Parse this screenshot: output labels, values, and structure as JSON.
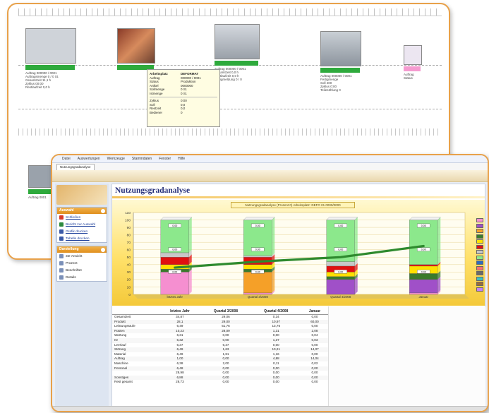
{
  "back_window": {
    "machines": [
      {
        "bar_color": "#2eaa3c",
        "img_color": "#cfd3d9",
        "text": "Auftrag 000000 / 0001\nAuftragsmenge 0 / 0 St.\nGesamtzeit 11,1 h\nZyklus 00:00\nRestlaufzeit 0,0 h"
      },
      {
        "bar_color": "#2eaa3c",
        "img_color": "#a7684e",
        "text": ""
      },
      {
        "bar_color": "#2eaa3c",
        "img_color": "#c2c6cc",
        "text": "Auftrag 000000 / 0001\nGesamtzeit 0,0 h\nRestlaufzeit 0,0 h\nFertigmeldung 0 / 0"
      },
      {
        "bar_color": "#2eaa3c",
        "img_color": "#b9c0c7",
        "text": "Auftrag 000000 / 0001\nFertigmenge\nSoll 400\nZyklus 0:00\nTeilezählung 0"
      },
      {
        "bar_color": "#f59bd0",
        "img_color": "#e9e3ef",
        "text": "Auftrag\nStatus"
      },
      {
        "bar_color": "#2eaa3c",
        "img_color": "#9aa2ab",
        "text": "Auftrag 0001"
      }
    ],
    "tooltip": {
      "rows": [
        [
          "Arbeitsplatz",
          "DEFORMAT"
        ],
        [
          "Auftrag",
          "000000 / 0001"
        ],
        [
          "Status",
          "Produktion"
        ],
        [
          "Artikel",
          "0000000"
        ],
        [
          "Sollmenge",
          "0 St."
        ],
        [
          "Istmenge",
          "0 St."
        ]
      ],
      "rows2": [
        [
          "Zyklus",
          "0:00"
        ],
        [
          "Soll",
          "0,0"
        ],
        [
          "Restzeit",
          "0,0"
        ],
        [
          "Bediener",
          "0"
        ]
      ]
    }
  },
  "menubar": [
    "Datei",
    "Auswertungen",
    "Werkzeuge",
    "Stammdaten",
    "Fenster",
    "Hilfe"
  ],
  "tab_label": "Nutzungsgradanalyse",
  "sidebar": {
    "panel1": {
      "title": "Auswahl",
      "items": [
        {
          "label": "Schließen",
          "color": "#d93a2b"
        },
        {
          "label": "Bericht zur Auswahl",
          "color": "#2e8a3e"
        },
        {
          "label": "Grafik drucken",
          "color": "#3b5aa8"
        },
        {
          "label": "Tabelle drucken",
          "color": "#3b5aa8"
        }
      ]
    },
    "panel2": {
      "title": "Darstellung",
      "items": [
        {
          "label": "3D-Ansicht",
          "color": "#7a8fb8"
        },
        {
          "label": "Prozent",
          "color": "#7a8fb8"
        },
        {
          "label": "Beschriftet",
          "color": "#7a8fb8"
        },
        {
          "label": "Details",
          "color": "#7a8fb8"
        }
      ]
    }
  },
  "page_title": "Nutzungsgradanalyse",
  "chart_data": {
    "type": "bar",
    "stacked": true,
    "title": "Nutzungsgradanalyse (Prozent 0)   Arbeitsplatz: DEFO 01   0000/0000",
    "categories": [
      "letztes Jahr",
      "Quartal 3/2008",
      "Quartal 4/2008",
      "Januar"
    ],
    "ylim": [
      0,
      110
    ],
    "yticks": [
      0,
      10,
      20,
      30,
      40,
      50,
      60,
      70,
      80,
      90,
      100,
      110
    ],
    "series": [
      {
        "color": "#f58fd0",
        "values": [
          30,
          2,
          0,
          2
        ]
      },
      {
        "color": "#a050c8",
        "values": [
          0,
          0,
          20,
          18
        ]
      },
      {
        "color": "#f5a028",
        "values": [
          0,
          28,
          0,
          0
        ]
      },
      {
        "color": "#3a7a2c",
        "values": [
          4,
          4,
          4,
          8
        ]
      },
      {
        "color": "#ffe000",
        "values": [
          6,
          6,
          6,
          10
        ]
      },
      {
        "color": "#e01010",
        "values": [
          10,
          10,
          8,
          2
        ]
      },
      {
        "color": "#c8c8c8",
        "values": [
          6,
          2,
          6,
          0
        ]
      },
      {
        "color": "#8ce88c",
        "values": [
          44,
          48,
          56,
          60
        ]
      }
    ],
    "trend": {
      "color": "#2e8a2e",
      "values": [
        36,
        44,
        50,
        65
      ]
    },
    "data_labels": [
      "0,00",
      "0,00",
      "0,00",
      "0,00",
      "0,00",
      "0,00"
    ],
    "legend_colors": [
      "#f58fd0",
      "#a050c8",
      "#f5a028",
      "#3a7a2c",
      "#ffe000",
      "#e01010",
      "#c8c8c8",
      "#8ce88c",
      "#2e6bbf",
      "#ff7070",
      "#6a6a6a",
      "#3cc0c0",
      "#9b6b3a",
      "#c080ff"
    ],
    "legend_placement": "right"
  },
  "table": {
    "headers": [
      "",
      "letztes Jahr",
      "Quartal 3/2008",
      "Quartal 4/2008",
      "Januar"
    ],
    "rows": [
      [
        "Gesamtzeit",
        "34,87",
        "29,06",
        "0,34",
        "0,00"
      ],
      [
        "Produkt",
        "28,1",
        "29,00",
        "10,97",
        "60,00"
      ],
      [
        "Leistungsstufe",
        "6,49",
        "51,76",
        "13,76",
        "0,00"
      ],
      [
        "Rüsten",
        "10,23",
        "28,09",
        "1,31",
        "2,08"
      ],
      [
        "Wartung",
        "6,31",
        "0,00",
        "0,00",
        "0,04"
      ],
      [
        "IO",
        "6,32",
        "0,00",
        "1,37",
        "0,03"
      ],
      [
        "Leerlauf",
        "6,37",
        "6,37",
        "0,00",
        "0,00"
      ],
      [
        "Störung",
        "6,49",
        "1,63",
        "10,21",
        "14,07"
      ],
      [
        "Material",
        "6,49",
        "1,81",
        "1,16",
        "0,00"
      ],
      [
        "Auftrag",
        "1,00",
        "0,00",
        "4,88",
        "14,04"
      ],
      [
        "Maschine",
        "6,38",
        "2,00",
        "0,11",
        "0,02"
      ],
      [
        "Personal",
        "6,48",
        "0,00",
        "0,00",
        "0,00"
      ],
      [
        "",
        "28,98",
        "0,00",
        "0,00",
        "0,00"
      ],
      [
        "Sonstiges",
        "6,88",
        "0,00",
        "0,00",
        "0,00"
      ],
      [
        "Rest gesamt",
        "28,73",
        "0,00",
        "0,00",
        "0,00"
      ]
    ]
  }
}
